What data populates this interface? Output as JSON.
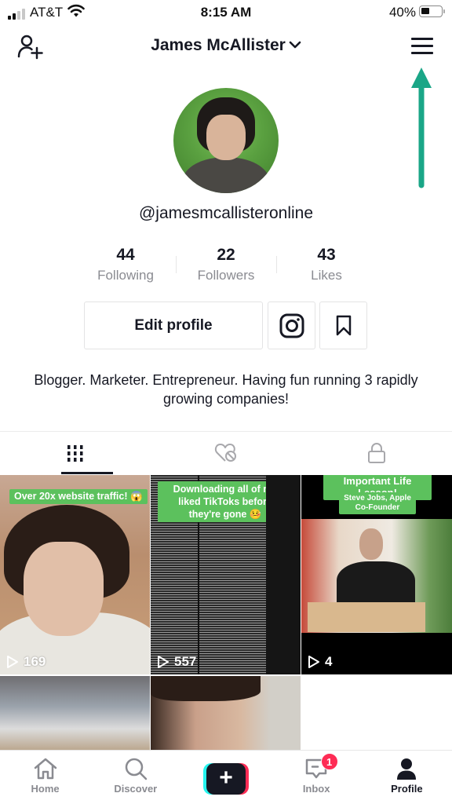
{
  "status_bar": {
    "carrier": "AT&T",
    "time": "8:15 AM",
    "battery": "40%",
    "battery_level": 0.4
  },
  "header": {
    "title": "James McAllister",
    "add_user_icon": "person-plus-icon",
    "menu_icon": "hamburger-menu-icon",
    "dropdown_icon": "chevron-down-icon"
  },
  "annotation": {
    "arrow_color": "#1aa687",
    "points_to": "menu"
  },
  "profile": {
    "username": "@jamesmcallisteronline",
    "stats": [
      {
        "value": "44",
        "label": "Following"
      },
      {
        "value": "22",
        "label": "Followers"
      },
      {
        "value": "43",
        "label": "Likes"
      }
    ],
    "edit_button": "Edit profile",
    "instagram_icon": "instagram-icon",
    "bookmark_icon": "bookmark-icon",
    "bio": "Blogger. Marketer. Entrepreneur. Having fun running 3 rapidly growing companies!"
  },
  "tabs": [
    {
      "name": "videos",
      "icon": "grid-bars-icon",
      "active": true
    },
    {
      "name": "liked",
      "icon": "heart-hidden-icon",
      "active": false
    },
    {
      "name": "private",
      "icon": "lock-icon",
      "active": false
    }
  ],
  "videos": [
    {
      "caption": "Over 20x website traffic! 😱",
      "views": "169"
    },
    {
      "caption": "Downloading all of my liked TikToks before they're gone 🤒",
      "views": "557"
    },
    {
      "caption": "Important Life Lesson!",
      "subcaption": "Steve Jobs, Apple Co-Founder",
      "views": "4"
    },
    {
      "caption": "",
      "views": ""
    },
    {
      "caption": "",
      "views": ""
    }
  ],
  "bottom_nav": [
    {
      "label": "Home",
      "icon": "home-icon"
    },
    {
      "label": "Discover",
      "icon": "search-icon"
    },
    {
      "label": "",
      "icon": "plus-icon"
    },
    {
      "label": "Inbox",
      "icon": "inbox-icon",
      "badge": "1"
    },
    {
      "label": "Profile",
      "icon": "profile-icon",
      "active": true
    }
  ],
  "colors": {
    "text": "#161823",
    "muted": "#8a8b91",
    "accent_red": "#fe2c55",
    "accent_cyan": "#25f4ee",
    "caption_green": "#5cc15d"
  }
}
